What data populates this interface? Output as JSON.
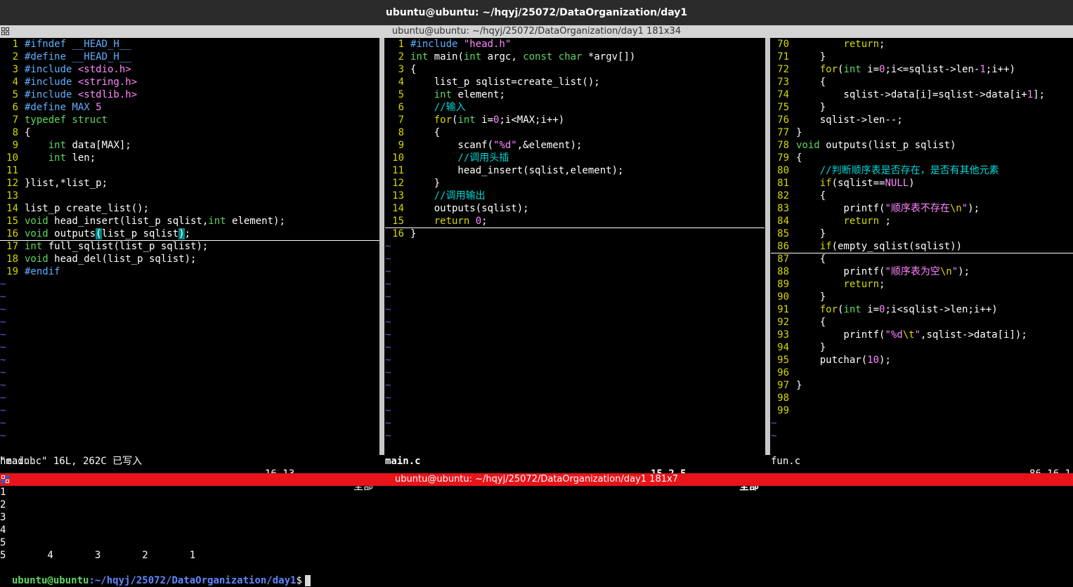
{
  "window": {
    "title": "ubuntu@ubuntu: ~/hqyj/25072/DataOrganization/day1",
    "top_terminal_title": "ubuntu@ubuntu: ~/hqyj/25072/DataOrganization/day1 181x34",
    "bottom_terminal_title": "ubuntu@ubuntu: ~/hqyj/25072/DataOrganization/day1 181x7"
  },
  "panes": {
    "head": {
      "status": {
        "file": "head.h",
        "pos": "16,13",
        "pct": "全部"
      },
      "lines": [
        {
          "n": "1",
          "t": [
            [
              "pre",
              "#ifndef __HEAD_H__"
            ]
          ]
        },
        {
          "n": "2",
          "t": [
            [
              "pre",
              "#define __HEAD_H__"
            ]
          ]
        },
        {
          "n": "3",
          "t": [
            [
              "pre",
              "#include "
            ],
            [
              "str",
              "<stdio.h>"
            ]
          ]
        },
        {
          "n": "4",
          "t": [
            [
              "pre",
              "#include "
            ],
            [
              "str",
              "<string.h>"
            ]
          ]
        },
        {
          "n": "5",
          "t": [
            [
              "pre",
              "#include "
            ],
            [
              "str",
              "<stdlib.h>"
            ]
          ]
        },
        {
          "n": "6",
          "t": [
            [
              "pre",
              "#define MAX "
            ],
            [
              "num",
              "5"
            ]
          ]
        },
        {
          "n": "7",
          "t": [
            [
              "typ",
              "typedef struct"
            ]
          ]
        },
        {
          "n": "8",
          "t": [
            [
              "",
              "{"
            ]
          ]
        },
        {
          "n": "9",
          "t": [
            [
              "",
              "    "
            ],
            [
              "typ",
              "int"
            ],
            [
              "",
              " data[MAX];"
            ]
          ]
        },
        {
          "n": "10",
          "t": [
            [
              "",
              "    "
            ],
            [
              "typ",
              "int"
            ],
            [
              "",
              " len;"
            ]
          ]
        },
        {
          "n": "11",
          "t": []
        },
        {
          "n": "12",
          "t": [
            [
              "",
              "}list,*list_p;"
            ]
          ]
        },
        {
          "n": "13",
          "t": []
        },
        {
          "n": "14",
          "t": [
            [
              "",
              "list_p create_list();"
            ]
          ]
        },
        {
          "n": "15",
          "t": [
            [
              "typ",
              "void"
            ],
            [
              "",
              " head_insert(list_p sqlist,"
            ],
            [
              "typ",
              "int"
            ],
            [
              "",
              " element);"
            ]
          ]
        },
        {
          "n": "16",
          "t": [
            [
              "typ",
              "void"
            ],
            [
              "",
              " outputs"
            ],
            [
              "hl",
              "("
            ],
            [
              "",
              "list_p sqlist"
            ],
            [
              "hl",
              ")"
            ],
            [
              "",
              ";"
            ]
          ],
          "cursor": true
        },
        {
          "n": "17",
          "t": [
            [
              "typ",
              "int"
            ],
            [
              "",
              " full_sqlist(list_p sqlist);"
            ]
          ]
        },
        {
          "n": "18",
          "t": [
            [
              "typ",
              "void"
            ],
            [
              "",
              " head_del(list_p sqlist);"
            ]
          ]
        },
        {
          "n": "19",
          "t": [
            [
              "pre",
              "#endif"
            ]
          ]
        }
      ]
    },
    "main": {
      "status": {
        "file": "main.c",
        "pos": "15,2-5",
        "pct": "全部"
      },
      "lines": [
        {
          "n": "1",
          "t": [
            [
              "pre",
              "#include "
            ],
            [
              "str",
              "\"head.h\""
            ]
          ]
        },
        {
          "n": "2",
          "t": [
            [
              "typ",
              "int"
            ],
            [
              "",
              " main("
            ],
            [
              "typ",
              "int"
            ],
            [
              "",
              " argc, "
            ],
            [
              "typ",
              "const char"
            ],
            [
              "",
              " *argv[])"
            ]
          ]
        },
        {
          "n": "3",
          "t": [
            [
              "",
              "{"
            ]
          ]
        },
        {
          "n": "4",
          "t": [
            [
              "",
              "    list_p sqlist=create_list();"
            ]
          ]
        },
        {
          "n": "5",
          "t": [
            [
              "",
              "    "
            ],
            [
              "typ",
              "int"
            ],
            [
              "",
              " element;"
            ]
          ]
        },
        {
          "n": "6",
          "t": [
            [
              "cmt",
              "    //输入"
            ]
          ]
        },
        {
          "n": "7",
          "t": [
            [
              "",
              "    "
            ],
            [
              "kw",
              "for"
            ],
            [
              "",
              "("
            ],
            [
              "typ",
              "int"
            ],
            [
              "",
              " i="
            ],
            [
              "num",
              "0"
            ],
            [
              "",
              ";i<MAX;i++)"
            ]
          ]
        },
        {
          "n": "8",
          "t": [
            [
              "",
              "    {"
            ]
          ]
        },
        {
          "n": "9",
          "t": [
            [
              "",
              "        scanf("
            ],
            [
              "str",
              "\"%d\""
            ],
            [
              "",
              ",&element);"
            ]
          ]
        },
        {
          "n": "10",
          "t": [
            [
              "cmt",
              "        //调用头插"
            ]
          ]
        },
        {
          "n": "11",
          "t": [
            [
              "",
              "        head_insert(sqlist,element);"
            ]
          ]
        },
        {
          "n": "12",
          "t": [
            [
              "",
              "    }"
            ]
          ]
        },
        {
          "n": "13",
          "t": [
            [
              "cmt",
              "    //调用输出"
            ]
          ]
        },
        {
          "n": "14",
          "t": [
            [
              "",
              "    outputs(sqlist);"
            ]
          ]
        },
        {
          "n": "15",
          "t": [
            [
              "",
              "    "
            ],
            [
              "kw",
              "return"
            ],
            [
              "",
              " "
            ],
            [
              "num",
              "0"
            ],
            [
              "",
              ";"
            ]
          ],
          "cursor": true
        },
        {
          "n": "16",
          "t": [
            [
              "",
              "}"
            ]
          ]
        }
      ]
    },
    "fun": {
      "status": {
        "file": "fun.c",
        "pos": "86,16-1"
      },
      "lines": [
        {
          "n": "70",
          "t": [
            [
              "",
              "        "
            ],
            [
              "kw",
              "return"
            ],
            [
              "",
              ";"
            ]
          ]
        },
        {
          "n": "71",
          "t": [
            [
              "",
              "    }"
            ]
          ]
        },
        {
          "n": "72",
          "t": [
            [
              "",
              "    "
            ],
            [
              "kw",
              "for"
            ],
            [
              "",
              "("
            ],
            [
              "typ",
              "int"
            ],
            [
              "",
              " i="
            ],
            [
              "num",
              "0"
            ],
            [
              "",
              ";i<=sqlist->len-"
            ],
            [
              "num",
              "1"
            ],
            [
              "",
              ";i++)"
            ]
          ]
        },
        {
          "n": "73",
          "t": [
            [
              "",
              "    {"
            ]
          ]
        },
        {
          "n": "74",
          "t": [
            [
              "",
              "        sqlist->data[i]=sqlist->data[i+"
            ],
            [
              "num",
              "1"
            ],
            [
              "",
              "];"
            ]
          ]
        },
        {
          "n": "75",
          "t": [
            [
              "",
              "    }"
            ]
          ]
        },
        {
          "n": "76",
          "t": [
            [
              "",
              "    sqlist->len--;"
            ]
          ]
        },
        {
          "n": "77",
          "t": [
            [
              "",
              "}"
            ]
          ]
        },
        {
          "n": "78",
          "t": [
            [
              "typ",
              "void"
            ],
            [
              "",
              " outputs(list_p sqlist)"
            ]
          ]
        },
        {
          "n": "79",
          "t": [
            [
              "",
              "{"
            ]
          ]
        },
        {
          "n": "80",
          "t": [
            [
              "cmt",
              "    //判断顺序表是否存在，是否有其他元素"
            ]
          ]
        },
        {
          "n": "81",
          "t": [
            [
              "",
              "    "
            ],
            [
              "kw",
              "if"
            ],
            [
              "",
              "(sqlist=="
            ],
            [
              "num",
              "NULL"
            ],
            [
              "",
              ")"
            ]
          ]
        },
        {
          "n": "82",
          "t": [
            [
              "",
              "    {"
            ]
          ]
        },
        {
          "n": "83",
          "t": [
            [
              "",
              "        printf("
            ],
            [
              "str",
              "\"顺序表不存在"
            ],
            [
              "kw",
              "\\n"
            ],
            [
              "str",
              "\""
            ],
            [
              "",
              ");"
            ]
          ]
        },
        {
          "n": "84",
          "t": [
            [
              "",
              "        "
            ],
            [
              "kw",
              "return"
            ],
            [
              "",
              " ;"
            ]
          ]
        },
        {
          "n": "85",
          "t": [
            [
              "",
              "    }"
            ]
          ]
        },
        {
          "n": "86",
          "t": [
            [
              "",
              "    "
            ],
            [
              "kw",
              "if"
            ],
            [
              "",
              "(empty_sqlist(sqlist))"
            ]
          ],
          "cursor": true
        },
        {
          "n": "87",
          "t": [
            [
              "",
              "    {"
            ]
          ]
        },
        {
          "n": "88",
          "t": [
            [
              "",
              "        printf("
            ],
            [
              "str",
              "\"顺序表为空"
            ],
            [
              "kw",
              "\\n"
            ],
            [
              "str",
              "\""
            ],
            [
              "",
              ");"
            ]
          ]
        },
        {
          "n": "89",
          "t": [
            [
              "",
              "        "
            ],
            [
              "kw",
              "return"
            ],
            [
              "",
              ";"
            ]
          ]
        },
        {
          "n": "90",
          "t": [
            [
              "",
              "    }"
            ]
          ]
        },
        {
          "n": "91",
          "t": [
            [
              "",
              "    "
            ],
            [
              "kw",
              "for"
            ],
            [
              "",
              "("
            ],
            [
              "typ",
              "int"
            ],
            [
              "",
              " i="
            ],
            [
              "num",
              "0"
            ],
            [
              "",
              ";i<sqlist->len;i++)"
            ]
          ]
        },
        {
          "n": "92",
          "t": [
            [
              "",
              "    {"
            ]
          ]
        },
        {
          "n": "93",
          "t": [
            [
              "",
              "        printf("
            ],
            [
              "str",
              "\"%d"
            ],
            [
              "kw",
              "\\t"
            ],
            [
              "str",
              "\""
            ],
            [
              "",
              ",sqlist->data[i]);"
            ]
          ]
        },
        {
          "n": "94",
          "t": [
            [
              "",
              "    }"
            ]
          ]
        },
        {
          "n": "95",
          "t": [
            [
              "",
              "    putchar("
            ],
            [
              "num",
              "10"
            ],
            [
              "",
              ");"
            ]
          ]
        },
        {
          "n": "96",
          "t": []
        },
        {
          "n": "97",
          "t": [
            [
              "",
              "}"
            ]
          ]
        },
        {
          "n": "98",
          "t": []
        },
        {
          "n": "99",
          "t": []
        }
      ]
    }
  },
  "cmdline": "\"main.c\" 16L, 262C 已写入",
  "output": [
    "1",
    "2",
    "3",
    "4",
    "5",
    "5       4       3       2       1"
  ],
  "prompt": {
    "user": "ubuntu@ubuntu",
    "path": ":~/hqyj/25072/DataOrganization/day1",
    "dollar": "$"
  },
  "colors": {
    "title_bg": "#2b2b2b",
    "active_bar": "#e8141a",
    "inactive_bar": "#d4d4d4",
    "line_number": "#d7d700",
    "comment": "#00d7d7",
    "string": "#ff87ff",
    "type": "#5fd75f",
    "preproc": "#5fafff",
    "tilde": "#5f5fd7"
  }
}
